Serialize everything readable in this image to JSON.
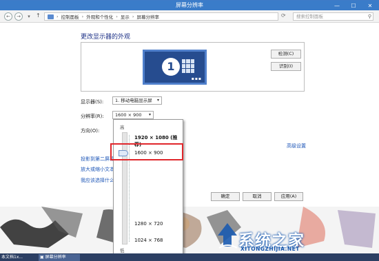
{
  "window": {
    "title": "屏幕分辨率",
    "controls": [
      "minimize",
      "maximize",
      "close"
    ]
  },
  "address": {
    "breadcrumbs": [
      "控制面板",
      "外观和个性化",
      "显示",
      "屏幕分辨率"
    ],
    "search_placeholder": "搜索控制面板"
  },
  "page": {
    "heading": "更改显示器的外观"
  },
  "preview": {
    "monitor_number": "1",
    "identify_label": "检测(C)",
    "detect_label": "识别(I)"
  },
  "form": {
    "display_label": "显示器(S):",
    "display_value": "1. 移动电脑显示屏",
    "resolution_label": "分辨率(R):",
    "resolution_value": "1600 × 900",
    "orientation_label": "方向(O):",
    "advanced_link": "高级设置"
  },
  "links": [
    "投影到第二屏幕",
    "放大或缩小文本",
    "我应该选择什么"
  ],
  "dropdown": {
    "high_label": "高",
    "low_label": "低",
    "options": [
      "1920 × 1080 (推荐)",
      "1600 × 900",
      "1280 × 720",
      "1024 × 768"
    ],
    "selected": "1600 × 900"
  },
  "buttons": {
    "ok": "确定",
    "cancel": "取消",
    "apply": "应用(A)"
  },
  "taskbar": {
    "items": [
      "本文档1x...",
      "屏幕分辨率"
    ]
  },
  "watermark": {
    "text": "系统之家",
    "url": "XITONGZHIJIA.NET"
  },
  "colors": {
    "titlebar": "#3a7cc9",
    "highlight": "#e0262b",
    "link": "#1d56b7"
  }
}
